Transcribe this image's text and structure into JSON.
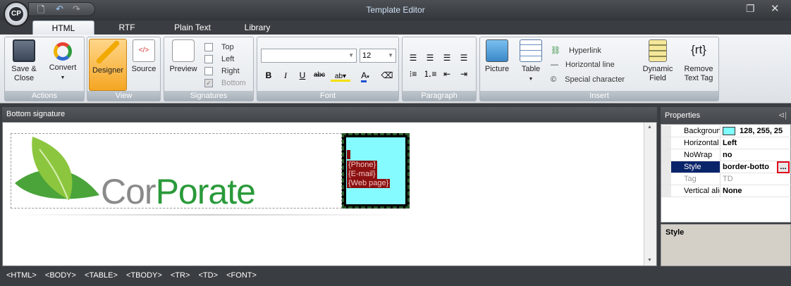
{
  "window": {
    "title": "Template Editor",
    "restore_icon": "restore-icon",
    "close_icon": "close-icon"
  },
  "quick_access": {
    "new_icon": "new-document-icon",
    "undo_icon": "undo-icon",
    "redo_icon": "redo-icon"
  },
  "tabs": [
    {
      "label": "HTML",
      "active": true
    },
    {
      "label": "RTF"
    },
    {
      "label": "Plain Text"
    },
    {
      "label": "Library"
    }
  ],
  "ribbon": {
    "actions": {
      "label": "Actions",
      "save_close": "Save &\nClose",
      "convert": "Convert"
    },
    "view": {
      "label": "View",
      "designer": "Designer",
      "source": "Source"
    },
    "signatures": {
      "label": "Signatures",
      "preview": "Preview",
      "top": "Top",
      "left": "Left",
      "right": "Right",
      "bottom": "Bottom"
    },
    "font": {
      "label": "Font",
      "font_name": "",
      "font_size": "12"
    },
    "paragraph": {
      "label": "Paragraph"
    },
    "insert": {
      "label": "Insert",
      "picture": "Picture",
      "table": "Table",
      "hyperlink": "Hyperlink",
      "horizontal_line": "Horizontal line",
      "special_character": "Special character",
      "dynamic_field": "Dynamic\nField",
      "remove_text_tag": "Remove\nText Tag",
      "rt_icon_text": "{rt}"
    }
  },
  "document": {
    "title": "Bottom signature",
    "logo_cor": "Cor",
    "logo_porate": "Porate",
    "fields": [
      "{Phone}",
      "{E-mail}",
      "{Web page}"
    ]
  },
  "properties": {
    "title": "Properties",
    "rows": [
      {
        "key": "Background c",
        "value": "128, 255, 25"
      },
      {
        "key": "Horizontal ali",
        "value": "Left"
      },
      {
        "key": "NoWrap",
        "value": "no"
      },
      {
        "key": "Style",
        "value": "border-botto",
        "selected": true
      },
      {
        "key": "Tag",
        "value": "TD"
      },
      {
        "key": "Vertical alignm",
        "value": "None"
      }
    ],
    "ellipsis": "...",
    "description_title": "Style"
  },
  "statusbar": {
    "path": "<HTML>  <BODY>  <TABLE>  <TBODY>  <TR>  <TD>  <FONT>"
  },
  "colors": {
    "cell_background": "#80ffff",
    "field_highlight": "#8b1010",
    "logo_green": "#2a9a3a"
  }
}
